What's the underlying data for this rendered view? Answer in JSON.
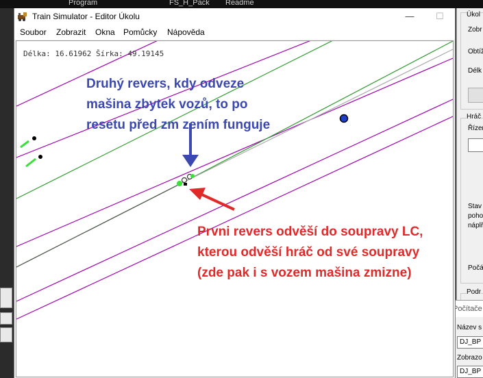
{
  "taskbar": {
    "items": [
      "Program",
      "FS_H_Pack",
      "Readme"
    ]
  },
  "window": {
    "title": "Train Simulator - Editor Úkolu",
    "controls": {
      "minimize": "—",
      "maximize": "☐",
      "close": "✕"
    }
  },
  "menu": [
    "Soubor",
    "Zobrazit",
    "Okna",
    "Pomůcky",
    "Nápověda"
  ],
  "canvas": {
    "coords": "Délka: 16.61962 Šírka: 49.19145",
    "note_blue": "Druhý revers, kdy odveze mašina zbytek vozů, to po resetu před zm zením funguje",
    "note_red": "Prvni revers odvěší do soupravy LC, kterou odvěší hráč od své soupravy (zde pak i s vozem mašina zmizne)",
    "colors": {
      "green_track": "#2e9a2e",
      "purple_track": "#a000b0",
      "gray_track": "#a9a9a9",
      "blue_arrow": "#3a48b0",
      "red_arrow": "#e02a2a"
    }
  },
  "right_panel": {
    "labels": [
      "Úkol",
      "Zobr",
      "Obtíž",
      "Délk",
      "Hráč",
      "Řízen",
      "Stav",
      "poho",
      "náplř",
      "Počá",
      "Podr"
    ]
  },
  "dialog": {
    "title": "Počítače",
    "label1": "Název s",
    "field1": "DJ_BP",
    "label2": "Zobrazo",
    "field2": "DJ_BP"
  }
}
